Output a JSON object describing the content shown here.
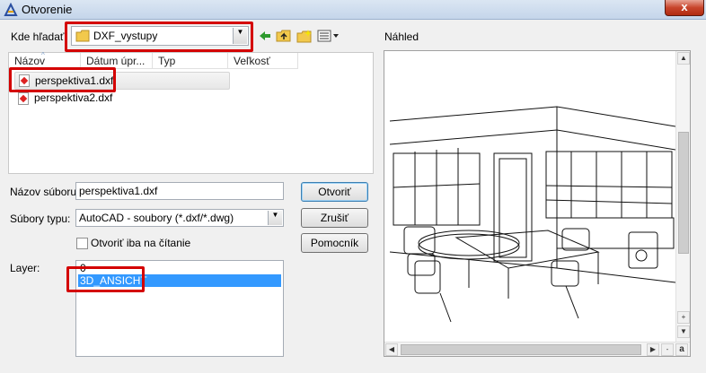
{
  "window": {
    "title": "Otvorenie",
    "close_label": "x"
  },
  "lookin": {
    "label": "Kde hľadať:",
    "value": "DXF_vystupy"
  },
  "preview": {
    "label": "Náhled"
  },
  "file_list": {
    "columns": [
      "Názov",
      "Dátum úpr...",
      "Typ",
      "Veľkosť"
    ],
    "files": [
      "perspektiva1.dxf",
      "perspektiva2.dxf"
    ]
  },
  "filename": {
    "label": "Názov súboru:",
    "value": "perspektiva1.dxf"
  },
  "filetype": {
    "label": "Súbory typu:",
    "value": "AutoCAD - soubory (*.dxf/*.dwg)"
  },
  "readonly": {
    "label": "Otvoriť iba na čítanie"
  },
  "layer": {
    "label": "Layer:",
    "items": [
      "0",
      "3D_ANSICHT"
    ]
  },
  "buttons": {
    "open": "Otvoriť",
    "cancel": "Zrušiť",
    "help": "Pomocník"
  },
  "zoom": {
    "plus": "+",
    "minus": "-",
    "a": "a"
  },
  "colors": {
    "selection": "#3399ff",
    "highlight_box": "#d40000",
    "title_bg": "#c4d5ea"
  }
}
